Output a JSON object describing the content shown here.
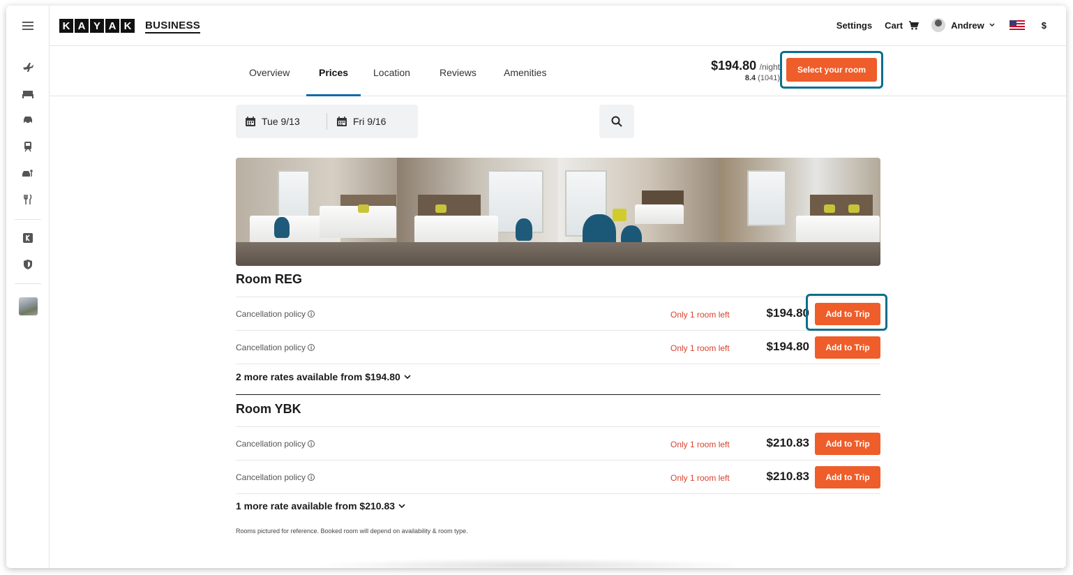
{
  "brand": {
    "letters": [
      "K",
      "A",
      "Y",
      "A",
      "K"
    ],
    "business": "BUSINESS"
  },
  "header": {
    "settings": "Settings",
    "cart": "Cart",
    "user": "Andrew",
    "currency": "$"
  },
  "sidebar": {
    "icons": [
      "menu-icon",
      "flight-icon",
      "hotel-icon",
      "car-icon",
      "train-icon",
      "car-rental-icon",
      "restaurant-icon",
      "kayak-k-icon",
      "shield-icon"
    ]
  },
  "tabs": [
    "Overview",
    "Prices",
    "Location",
    "Reviews",
    "Amenities"
  ],
  "active_tab": "Prices",
  "summary": {
    "price": "$194.80",
    "per": "/night",
    "score": "8.4",
    "reviews": "(1041)",
    "select_label": "Select your room"
  },
  "dates": {
    "checkin": "Tue 9/13",
    "checkout": "Fri 9/16"
  },
  "rooms": [
    {
      "title": "Room REG",
      "rates": [
        {
          "policy": "Cancellation policy",
          "availability": "Only 1 room left",
          "price": "$194.80",
          "button": "Add to Trip"
        },
        {
          "policy": "Cancellation policy",
          "availability": "Only 1 room left",
          "price": "$194.80",
          "button": "Add to Trip"
        }
      ],
      "more": "2 more rates available from $194.80"
    },
    {
      "title": "Room YBK",
      "rates": [
        {
          "policy": "Cancellation policy",
          "availability": "Only 1 room left",
          "price": "$210.83",
          "button": "Add to Trip"
        },
        {
          "policy": "Cancellation policy",
          "availability": "Only 1 room left",
          "price": "$210.83",
          "button": "Add to Trip"
        }
      ],
      "more": "1 more rate available from $210.83"
    }
  ],
  "footnote": "Rooms pictured for reference. Booked room will depend on availability & room type.",
  "colors": {
    "accent": "#ee5d2a",
    "highlight": "#0b6e8c",
    "tab_underline": "#0f6ba8",
    "availability": "#d9412e"
  }
}
